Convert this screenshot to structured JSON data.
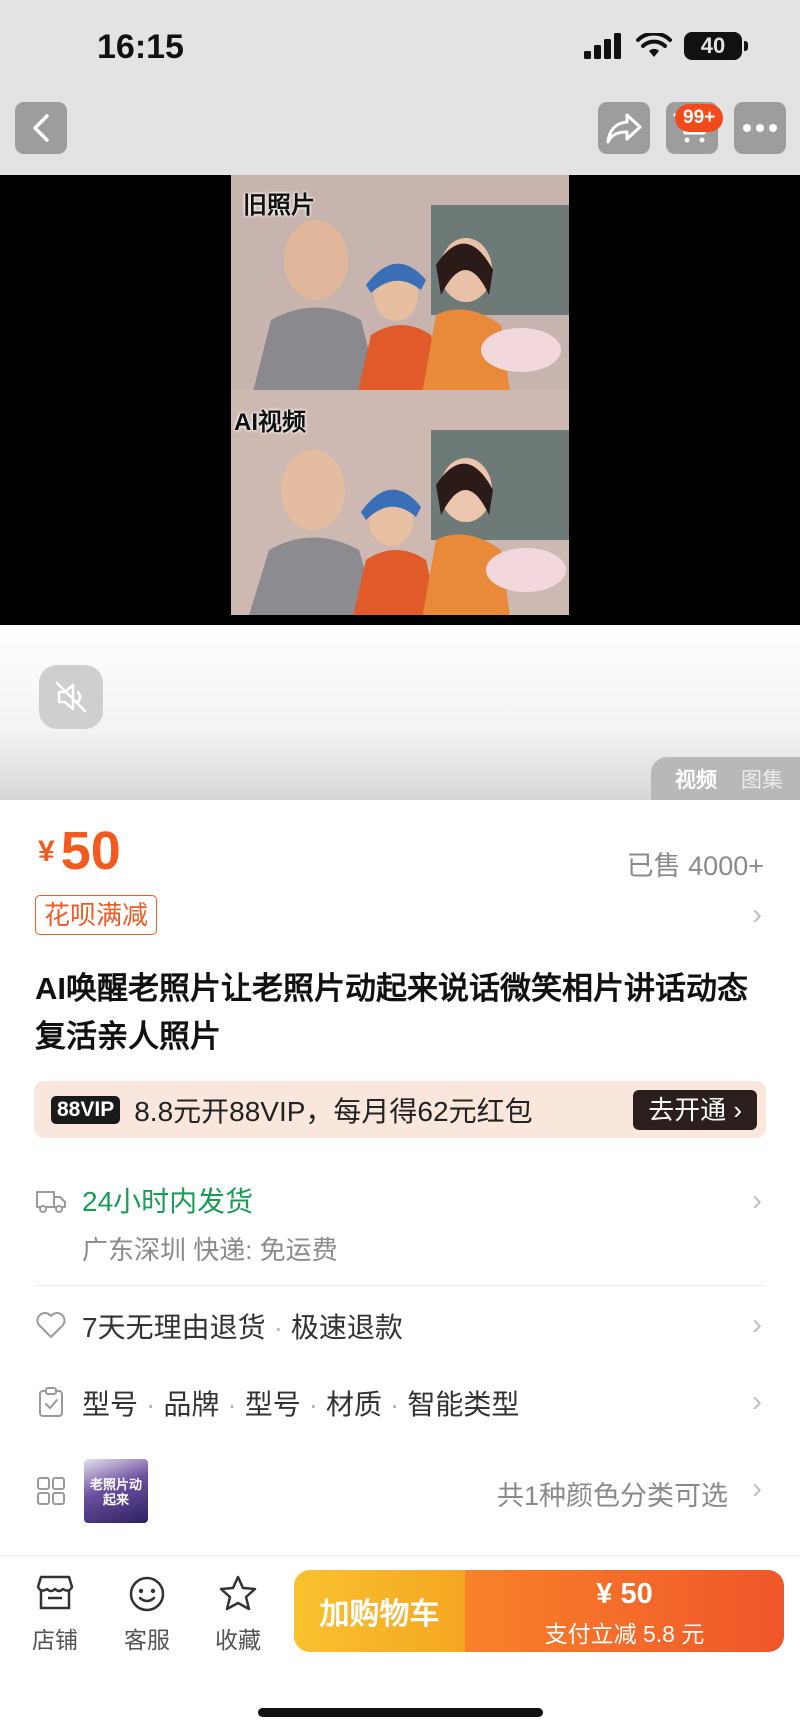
{
  "status_bar": {
    "time": "16:15",
    "battery": "40"
  },
  "nav": {
    "cart_badge": "99+"
  },
  "media": {
    "label_old": "旧照片",
    "label_ai": "AI视频",
    "tabs": [
      {
        "label": "视频",
        "active": true
      },
      {
        "label": "图集",
        "active": false
      }
    ]
  },
  "product": {
    "currency": "¥",
    "price": "50",
    "sold": "已售 4000+",
    "promo_tag": "花呗满减",
    "title": "AI唤醒老照片让老照片动起来说话微笑相片讲话动态复活亲人照片"
  },
  "vip": {
    "badge": "88VIP",
    "text": "8.8元开88VIP，每月得62元红包",
    "button": "去开通"
  },
  "shipping": {
    "title": "24小时内发货",
    "details": "广东深圳  快递: 免运费"
  },
  "returns": {
    "policy_1": "7天无理由退货",
    "policy_2": "极速退款"
  },
  "specs": [
    "型号",
    "品牌",
    "型号",
    "材质",
    "智能类型"
  ],
  "sku": {
    "thumb_text": "老照片动起来",
    "summary": "共1种颜色分类可选"
  },
  "bottom_bar": {
    "store": "店铺",
    "service": "客服",
    "favorite": "收藏",
    "add_to_cart": "加购物车",
    "buy_price": "¥ 50",
    "buy_discount": "支付立减 5.8 元"
  },
  "colors": {
    "accent": "#f25a20",
    "ship_green": "#1a9c57",
    "vip_bg": "#f9e6dc"
  }
}
